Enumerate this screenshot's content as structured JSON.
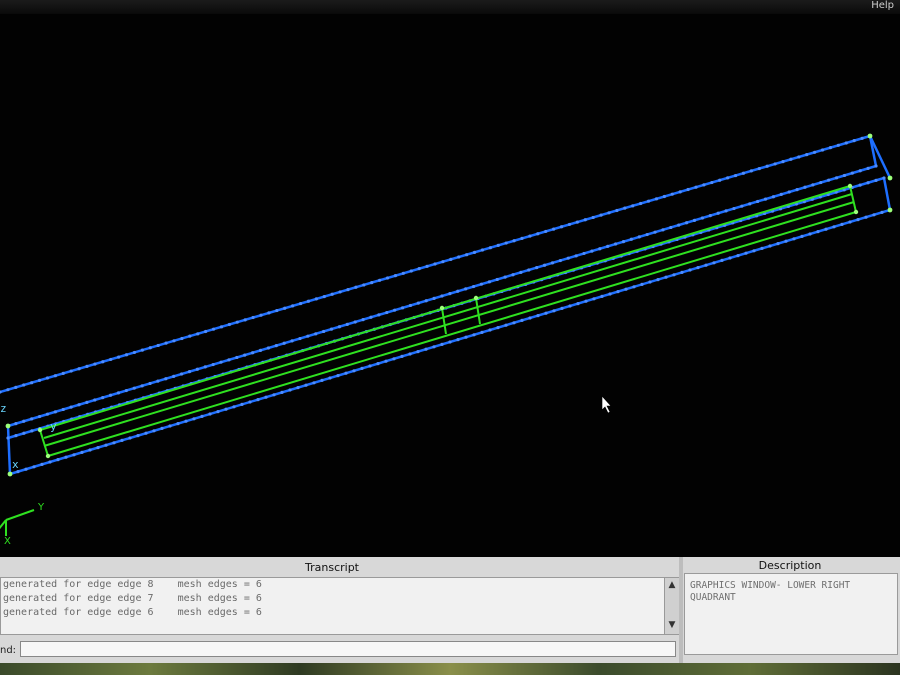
{
  "window": {
    "help_label": "Help"
  },
  "viewport": {
    "axis_labels": {
      "z": "z",
      "y_upper": "y",
      "x": "x"
    },
    "triad_labels": {
      "y": "Y",
      "x": "X"
    },
    "colors": {
      "mesh": "#1e6fff",
      "geometry": "#2fe020",
      "background": "#020202"
    }
  },
  "transcript": {
    "title": "Transcript",
    "lines": [
      "generated for edge edge 8    mesh edges = 6",
      "generated for edge edge 7    mesh edges = 6",
      "generated for edge edge 6    mesh edges = 6"
    ]
  },
  "description": {
    "title": "Description",
    "text": "GRAPHICS WINDOW- LOWER RIGHT QUADRANT"
  },
  "command": {
    "label": "nd:",
    "value": ""
  }
}
